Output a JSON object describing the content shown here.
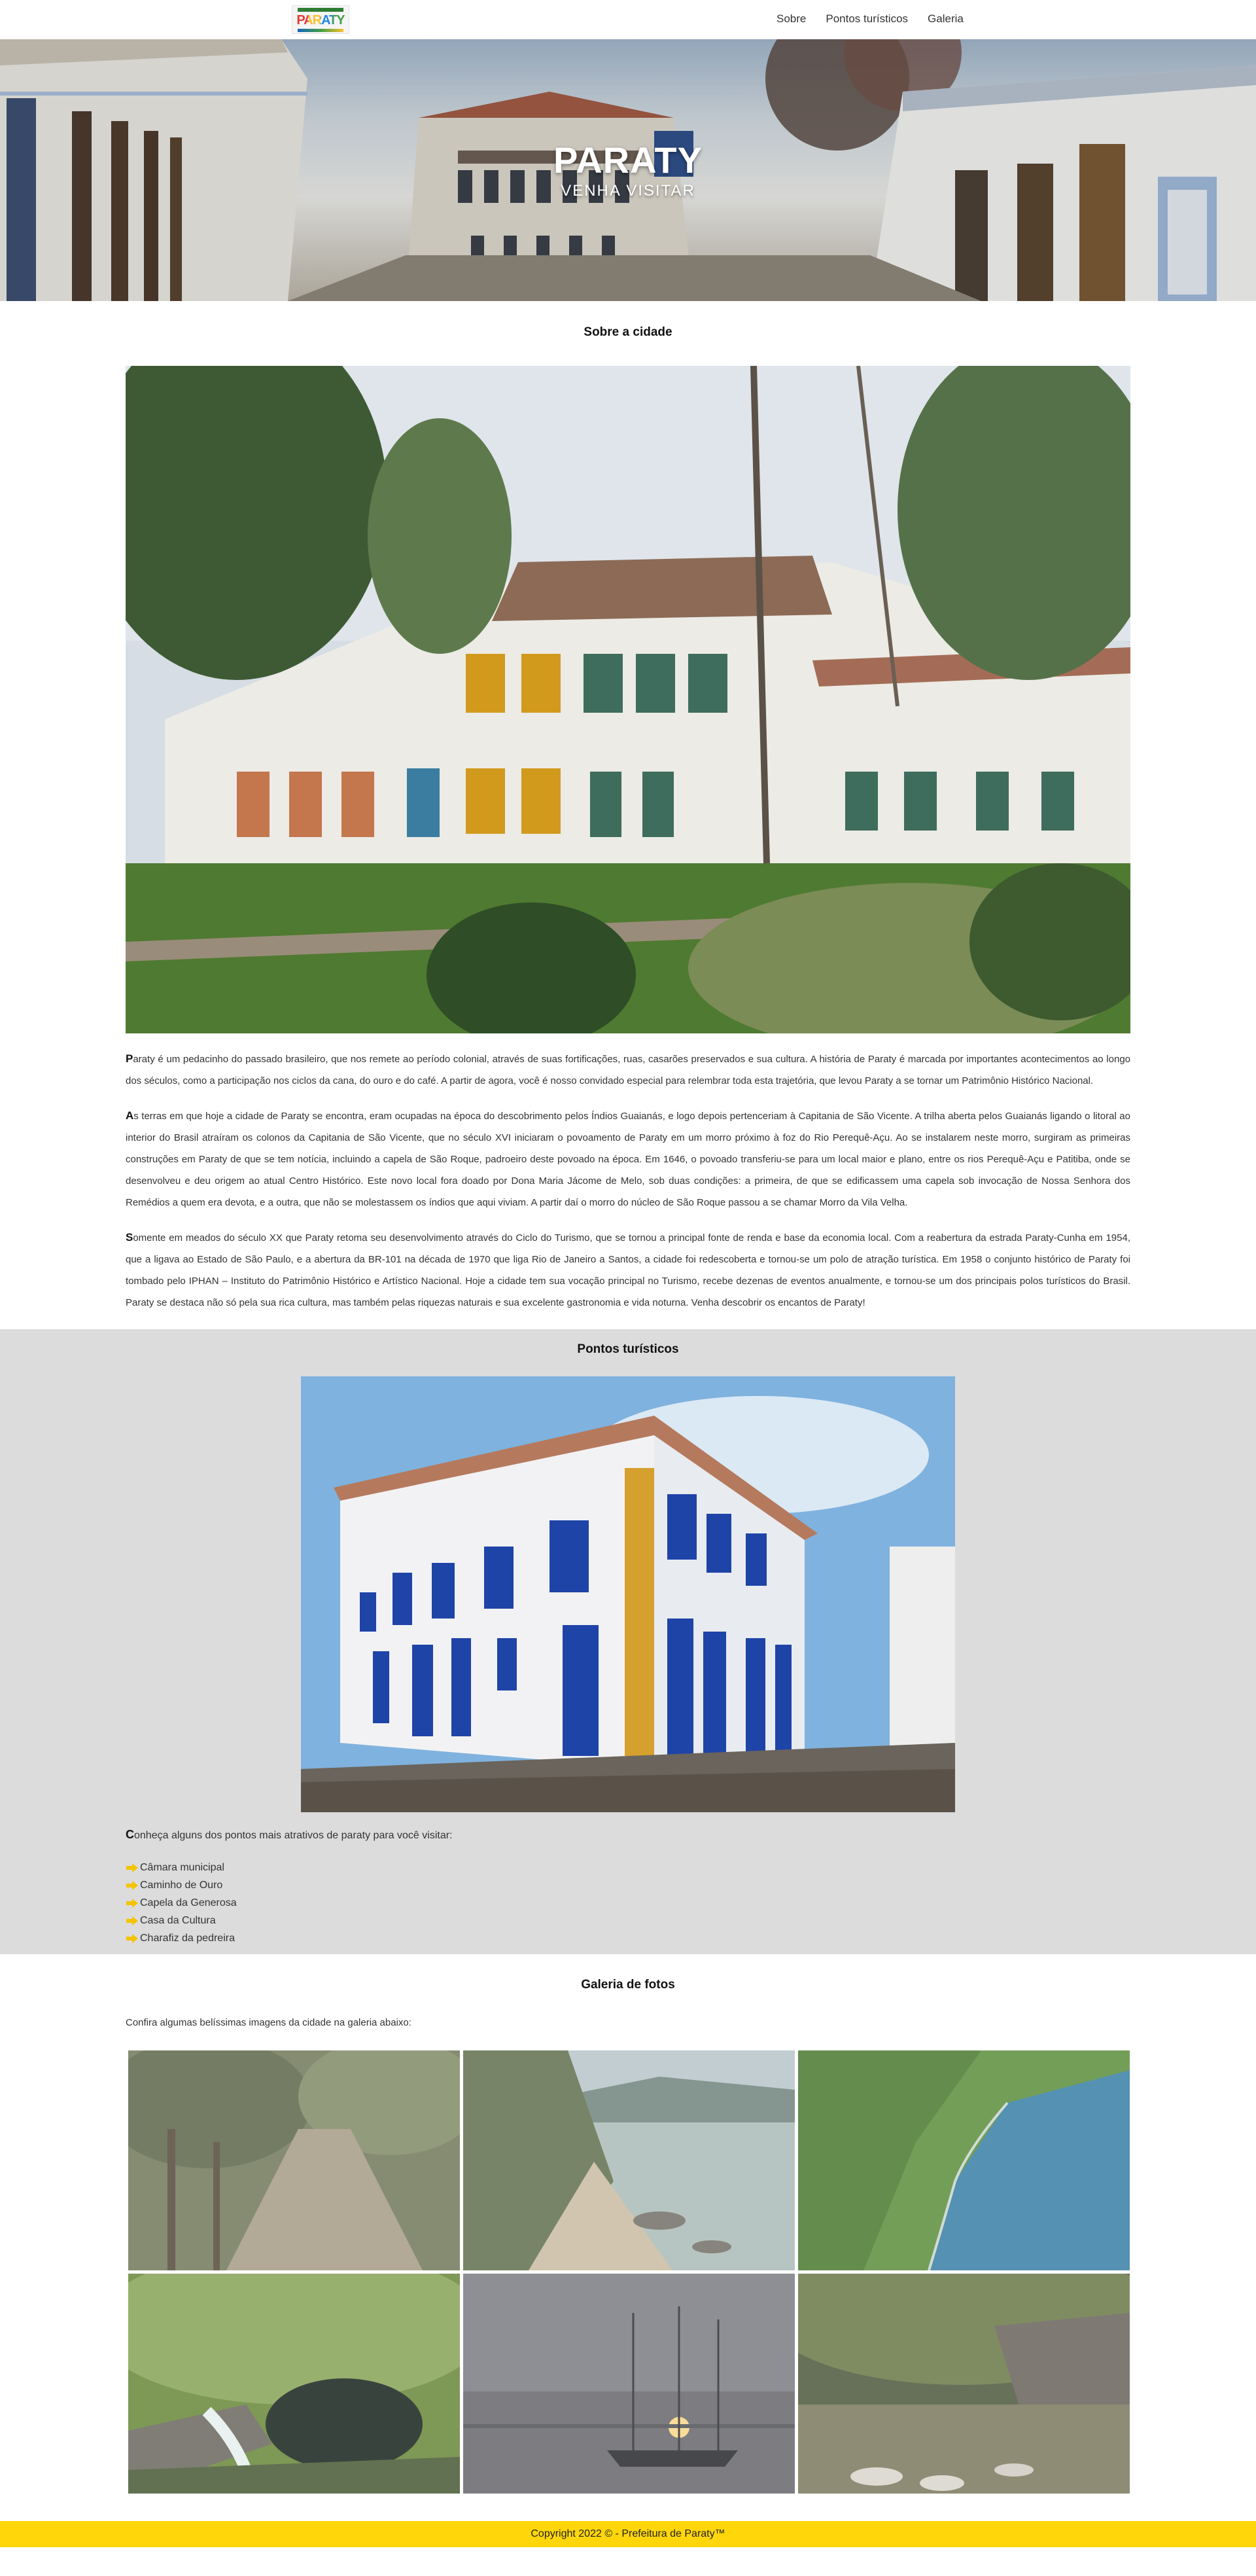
{
  "nav": {
    "logo_label": "PARATY",
    "links": [
      "Sobre",
      "Pontos turísticos",
      "Galeria"
    ]
  },
  "hero": {
    "title": "PARATY",
    "subtitle": "VENHA VISITAR"
  },
  "about": {
    "title": "Sobre a cidade",
    "paragraphs": [
      {
        "cap": "P",
        "text": "araty é um pedacinho do passado brasileiro, que nos remete ao período colonial, através de suas fortificações, ruas, casarões preservados e sua cultura. A história de Paraty é marcada por importantes acontecimentos ao longo dos séculos, como a participação nos ciclos da cana, do ouro e do café. A partir de agora, você é nosso convidado especial para relembrar toda esta trajetória, que levou Paraty a se tornar um Patrimônio Histórico Nacional."
      },
      {
        "cap": "A",
        "text": "s terras em que hoje a cidade de Paraty se encontra, eram ocupadas na época do descobrimento pelos Índios Guaianás, e logo depois pertenceriam à Capitania de São Vicente. A trilha aberta pelos Guaianás ligando o litoral ao interior do Brasil atraíram os colonos da Capitania de São Vicente, que no século XVI iniciaram o povoamento de Paraty em um morro próximo à foz do Rio Perequê-Açu. Ao se instalarem neste morro, surgiram as primeiras construções em Paraty de que se tem notícia, incluindo a capela de São Roque, padroeiro deste povoado na época. Em 1646, o povoado transferiu-se para um local maior e plano, entre os rios Perequê-Açu e Patitiba, onde se desenvolveu e deu origem ao atual Centro Histórico. Este novo local fora doado por Dona Maria Jácome de Melo, sob duas condições: a primeira, de que se edificassem uma capela sob invocação de Nossa Senhora dos Remédios a quem era devota, e a outra, que não se molestassem os índios que aqui viviam. A partir daí o morro do núcleo de São Roque passou a se chamar Morro da Vila Velha."
      },
      {
        "cap": "S",
        "text": "omente em meados do século XX que Paraty retoma seu desenvolvimento através do Ciclo do Turismo, que se tornou a principal fonte de renda e base da economia local. Com a reabertura da estrada Paraty-Cunha em 1954, que a ligava ao Estado de São Paulo, e a abertura da BR-101 na década de 1970 que liga Rio de Janeiro a Santos, a cidade foi redescoberta e tornou-se um polo de atração turística. Em 1958 o conjunto histórico de Paraty foi tombado pelo IPHAN – Instituto do Patrimônio Histórico e Artístico Nacional. Hoje a cidade tem sua vocação principal no Turismo, recebe dezenas de eventos anualmente, e tornou-se um dos principais polos turísticos do Brasil. Paraty se destaca não só pela sua rica cultura, mas também pelas riquezas naturais e sua excelente gastronomia e vida noturna. Venha descobrir os encantos de Paraty!"
      }
    ]
  },
  "tour": {
    "title": "Pontos turísticos",
    "intro_cap": "C",
    "intro_text": "onheça alguns dos pontos mais atrativos de paraty para você visitar:",
    "items": [
      "Câmara municipal",
      "Caminho de Ouro",
      "Capela da Generosa",
      "Casa da Cultura",
      "Charafiz da pedreira"
    ],
    "arrow_icon": "arrow-right-icon",
    "arrow_color": "#f5c400"
  },
  "gallery": {
    "title": "Galeria de fotos",
    "intro": "Confira algumas belíssimas imagens da cidade na galeria abaixo:"
  },
  "footer": {
    "text": "Copyright 2022 © - Prefeitura de Paraty™"
  },
  "colors": {
    "footer_bg": "#ffd60a",
    "tour_bg": "#dcdcdc"
  }
}
